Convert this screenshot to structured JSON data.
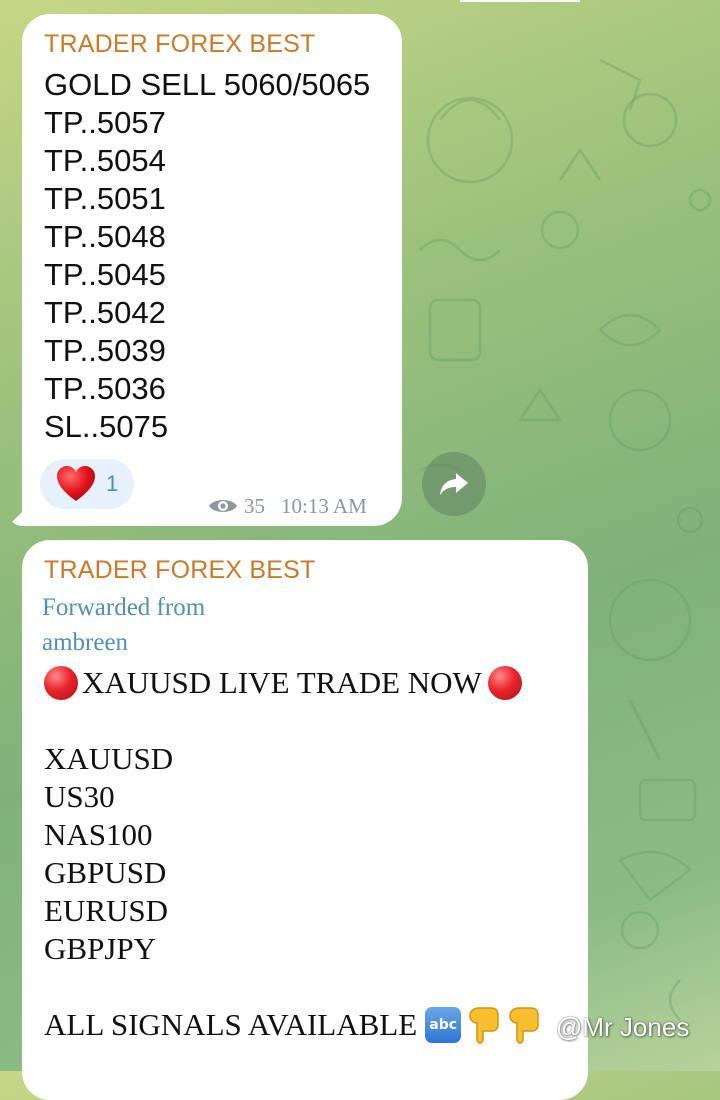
{
  "colors": {
    "sender_name": "#c97a2a",
    "forwarded_link": "#4f8fb8",
    "reaction_bg": "#e7f1fb",
    "reaction_count": "#3d8fd6",
    "meta_text": "#8d979e"
  },
  "messages": [
    {
      "sender": "TRADER FOREX BEST",
      "lines": [
        "GOLD SELL 5060/5065",
        "TP..5057",
        "TP..5054",
        "TP..5051",
        "TP..5048",
        "TP..5045",
        "TP..5042",
        "TP..5039",
        "TP..5036",
        "SL..5075"
      ],
      "reaction": {
        "icon": "red-heart-icon",
        "count": "1"
      },
      "views": "35",
      "time": "10:13 AM",
      "share_icon": "share-arrow-icon"
    },
    {
      "sender": "TRADER FOREX BEST",
      "forwarded_label": "Forwarded from",
      "forwarded_from": "ambreen",
      "headline": "XAUUSD LIVE TRADE NOW",
      "headline_icons": [
        "red-circle-icon",
        "red-circle-icon"
      ],
      "pairs": [
        "XAUUSD",
        "US30",
        "NAS100",
        "GBPUSD",
        "EURUSD",
        "GBPJPY"
      ],
      "footer": "ALL SIGNALS AVAILABLE",
      "footer_icons": [
        "abc-icon",
        "pointing-down-icon",
        "pointing-down-icon"
      ],
      "abc_glyph": "abc"
    }
  ],
  "watermark": "@Mr Jones"
}
